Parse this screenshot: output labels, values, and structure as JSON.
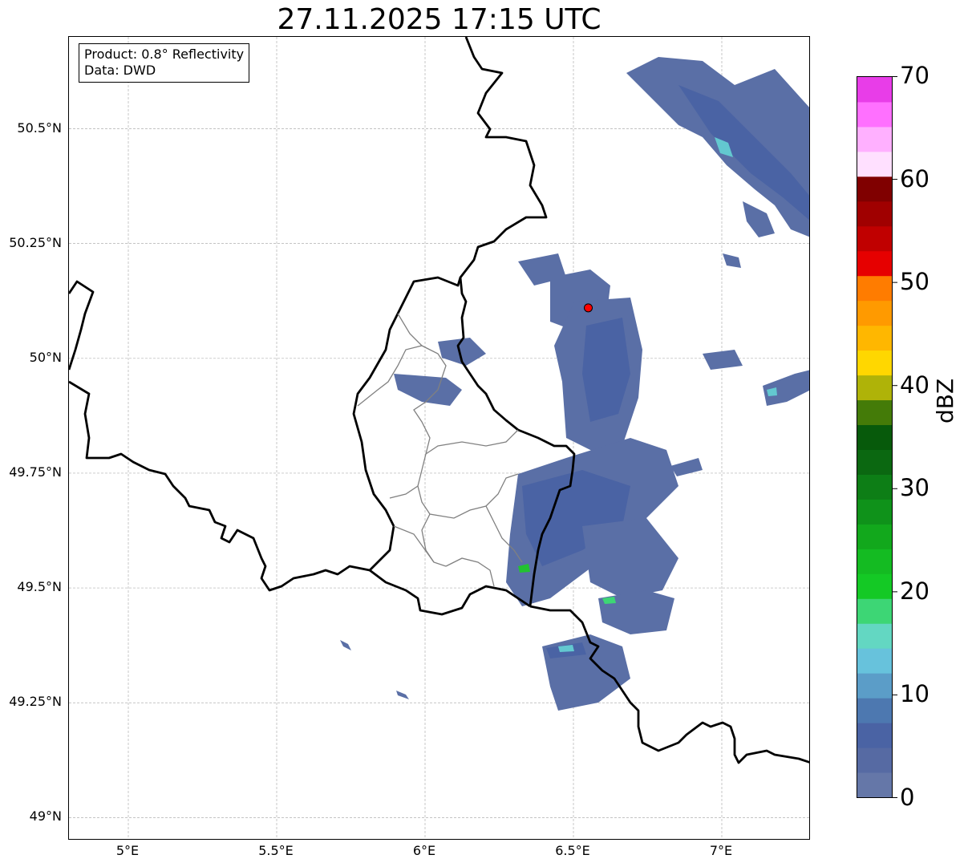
{
  "title": "27.11.2025 17:15 UTC",
  "info": {
    "product": "Product: 0.8° Reflectivity",
    "source": "Data: DWD"
  },
  "axes": {
    "lon_range": [
      4.8,
      7.3
    ],
    "lat_range": [
      48.95,
      50.7
    ],
    "lon_ticks": [
      {
        "value": 5.0,
        "label": "5°E"
      },
      {
        "value": 5.5,
        "label": "5.5°E"
      },
      {
        "value": 6.0,
        "label": "6°E"
      },
      {
        "value": 6.5,
        "label": "6.5°E"
      },
      {
        "value": 7.0,
        "label": "7°E"
      }
    ],
    "lat_ticks": [
      {
        "value": 50.5,
        "label": "50.5°N"
      },
      {
        "value": 50.25,
        "label": "50.25°N"
      },
      {
        "value": 50.0,
        "label": "50°N"
      },
      {
        "value": 49.75,
        "label": "49.75°N"
      },
      {
        "value": 49.5,
        "label": "49.5°N"
      },
      {
        "value": 49.25,
        "label": "49.25°N"
      },
      {
        "value": 49.0,
        "label": "49°N"
      }
    ],
    "grid": true
  },
  "radar_site": {
    "lon": 6.55,
    "lat": 50.11,
    "color": "#ff0000"
  },
  "colorbar": {
    "label": "dBZ",
    "min": 0,
    "max": 70,
    "ticks": [
      {
        "value": 0,
        "label": "0"
      },
      {
        "value": 10,
        "label": "10"
      },
      {
        "value": 20,
        "label": "20"
      },
      {
        "value": 30,
        "label": "30"
      },
      {
        "value": 40,
        "label": "40"
      },
      {
        "value": 50,
        "label": "50"
      },
      {
        "value": 60,
        "label": "60"
      },
      {
        "value": 70,
        "label": "70"
      }
    ],
    "colors": [
      "#6577a8",
      "#566aa3",
      "#4a63a4",
      "#4d78b0",
      "#5b9dc8",
      "#67c2dc",
      "#63d7c2",
      "#3dd675",
      "#14c925",
      "#14bb22",
      "#12a81c",
      "#0f921a",
      "#0d7e16",
      "#0b6811",
      "#075a0b",
      "#447b08",
      "#afb308",
      "#ffd700",
      "#ffb700",
      "#ff9a00",
      "#ff7c00",
      "#e60000",
      "#c00000",
      "#a00000",
      "#800000",
      "#ffe0ff",
      "#ffb0ff",
      "#ff70ff",
      "#e83de8"
    ]
  },
  "chart_data": {
    "type": "heatmap",
    "title": "27.11.2025 17:15 UTC",
    "xlabel": "",
    "ylabel": "",
    "xlim": [
      4.8,
      7.3
    ],
    "ylim": [
      48.95,
      50.7
    ],
    "colorbar_label": "dBZ",
    "value_range": [
      0,
      70
    ],
    "echo_areas": [
      {
        "lon": [
          6.7,
          7.3
        ],
        "lat": [
          50.27,
          50.7
        ],
        "max_dbz": 17
      },
      {
        "lon": [
          6.35,
          6.7
        ],
        "lat": [
          49.75,
          50.2
        ],
        "max_dbz": 8
      },
      {
        "lon": [
          6.28,
          6.9
        ],
        "lat": [
          49.46,
          49.82
        ],
        "max_dbz": 22
      },
      {
        "lon": [
          6.38,
          6.8
        ],
        "lat": [
          49.23,
          49.45
        ],
        "max_dbz": 17
      },
      {
        "lon": [
          7.15,
          7.3
        ],
        "lat": [
          49.9,
          49.98
        ],
        "max_dbz": 15
      },
      {
        "lon": [
          5.9,
          6.3
        ],
        "lat": [
          49.88,
          50.02
        ],
        "max_dbz": 5
      }
    ]
  }
}
